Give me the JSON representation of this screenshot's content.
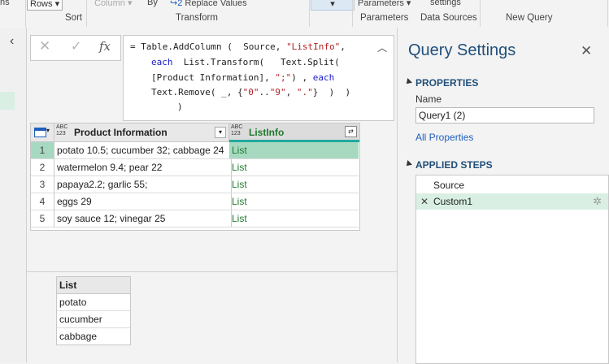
{
  "ribbon": {
    "items": [
      "ns",
      "Rows",
      "Column",
      "By",
      "Replace Values",
      "Parameters",
      "settings"
    ],
    "groups": [
      "Sort",
      "Transform",
      "Parameters",
      "Data Sources",
      "New Query"
    ]
  },
  "formula": {
    "line1_a": "= Table.AddColumn (  Source, ",
    "line1_s": "\"ListInfo\"",
    "line1_b": ",",
    "line2_kw": "each",
    "line2_rest": "  List.Transform(   Text.Split(",
    "line3_a": "[Product Information], ",
    "line3_s": "\";\"",
    "line3_b": ") , ",
    "line3_kw": "each",
    "line4_a": "Text.Remove( _, {",
    "line4_s1": "\"0\"",
    "line4_dots": "..",
    "line4_s2": "\"9\"",
    "line4_c": ", ",
    "line4_s3": "\".\"",
    "line4_end": "}  )  )",
    "line5": ")"
  },
  "grid": {
    "col1_type": "ABC\n123",
    "col1_name": "Product Information",
    "col2_type": "ABC\n123",
    "col2_name": "ListInfo",
    "rows": [
      {
        "n": "1",
        "a": "potato 10.5; cucumber 32; cabbage 24",
        "b": "List"
      },
      {
        "n": "2",
        "a": "watermelon 9.4; pear 22",
        "b": "List"
      },
      {
        "n": "3",
        "a": "papaya2.2; garlic 55;",
        "b": "List"
      },
      {
        "n": "4",
        "a": "eggs 29",
        "b": "List"
      },
      {
        "n": "5",
        "a": "soy sauce 12; vinegar 25",
        "b": "List"
      }
    ]
  },
  "preview": {
    "header": "List",
    "items": [
      "potato",
      "cucumber",
      "cabbage"
    ]
  },
  "settings": {
    "title": "Query Settings",
    "properties_title": "PROPERTIES",
    "name_label": "Name",
    "name_value": "Query1 (2)",
    "all_properties": "All Properties",
    "steps_title": "APPLIED STEPS",
    "steps": [
      "Source",
      "Custom1"
    ]
  }
}
